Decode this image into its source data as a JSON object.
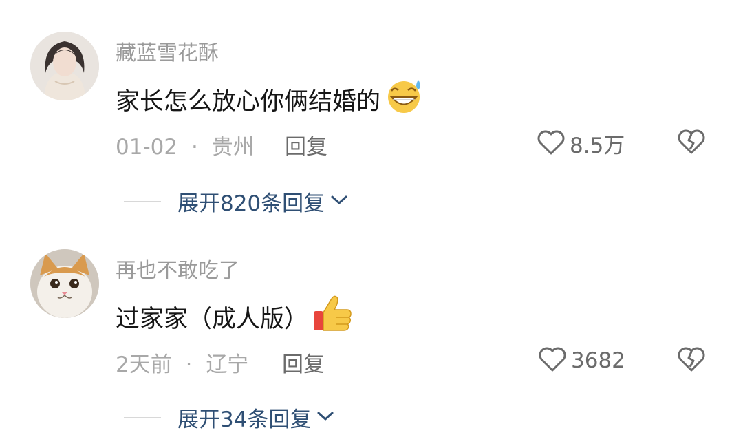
{
  "comments": [
    {
      "username": "藏蓝雪花酥",
      "text": "家长怎么放心你俩结婚的",
      "emoji_icon": "grinning-sweat-emoji",
      "date": "01-02",
      "separator": "·",
      "location": "贵州",
      "reply_label": "回复",
      "likes": "8.5万",
      "expand_label": "展开820条回复"
    },
    {
      "username": "再也不敢吃了",
      "text": "过家家（成人版）",
      "emoji_icon": "thumbs-up-emoji",
      "date": "2天前",
      "separator": "·",
      "location": "辽宁",
      "reply_label": "回复",
      "likes": "3682",
      "expand_label": "展开34条回复"
    }
  ],
  "colors": {
    "username": "#9a9a9a",
    "text": "#161616",
    "meta": "#a8a8a8",
    "action": "#6b6b6b",
    "expand": "#2f4f74"
  }
}
